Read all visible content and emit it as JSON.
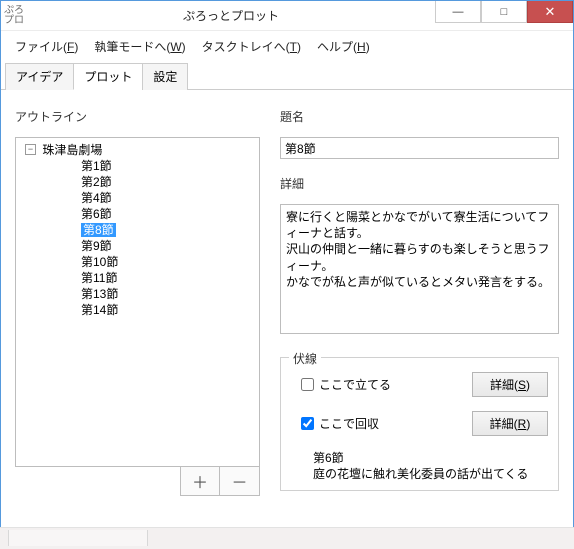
{
  "window": {
    "app_icon_text": "ぷろ\nプロ",
    "title": "ぷろっとプロット",
    "min": "—",
    "max": "□",
    "close": "✕"
  },
  "menu": {
    "file": "ファイル(F)",
    "mode": "執筆モードへ(W)",
    "tray": "タスクトレイへ(T)",
    "help": "ヘルプ(H)"
  },
  "tabs": {
    "idea": "アイデア",
    "plot": "プロット",
    "settings": "設定"
  },
  "outline": {
    "label": "アウトライン",
    "root": "珠津島劇場",
    "items": [
      "第1節",
      "第2節",
      "第4節",
      "第6節",
      "第8節",
      "第9節",
      "第10節",
      "第11節",
      "第13節",
      "第14節"
    ],
    "selected_index": 4,
    "add": "＋",
    "remove": "－"
  },
  "fields": {
    "title_label": "題名",
    "title_value": "第8節",
    "detail_label": "詳細",
    "detail_value": "寮に行くと陽菜とかなでがいて寮生活についてフィーナと話す。\n沢山の仲間と一緒に暮らすのも楽しそうと思うフィーナ。\nかなでが私と声が似ているとメタい発言をする。"
  },
  "foreshadow": {
    "legend": "伏線",
    "plant_label": "ここで立てる",
    "plant_checked": false,
    "plant_btn": "詳細(S)",
    "recover_label": "ここで回収",
    "recover_checked": true,
    "recover_btn": "詳細(R)",
    "note_title": "第6節",
    "note_body": "庭の花壇に触れ美化委員の話が出てくる"
  }
}
